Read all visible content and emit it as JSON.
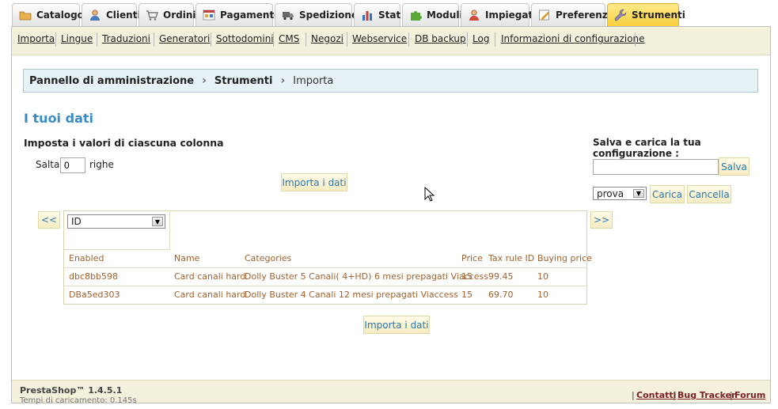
{
  "tabs": [
    {
      "label": "Catalogo",
      "icon": "folder-icon",
      "color": "#e3a53b"
    },
    {
      "label": "Clienti",
      "icon": "user-icon",
      "color": "#4a7bbf"
    },
    {
      "label": "Ordini",
      "icon": "cart-icon",
      "color": "#888888"
    },
    {
      "label": "Pagamento",
      "icon": "payment-icon",
      "color": "#c04040"
    },
    {
      "label": "Spedizione",
      "icon": "truck-icon",
      "color": "#555555"
    },
    {
      "label": "Stat",
      "icon": "bar-chart-icon",
      "color": "#3b6fc4"
    },
    {
      "label": "Moduli",
      "icon": "puzzle-icon",
      "color": "#5aa83a"
    },
    {
      "label": "Impiegati",
      "icon": "employee-icon",
      "color": "#d04a3a"
    },
    {
      "label": "Preferenze",
      "icon": "preferences-icon",
      "color": "#d9a23a"
    },
    {
      "label": "Strumenti",
      "icon": "wrench-icon",
      "color": "#6a6aa8"
    }
  ],
  "subnav": [
    "Importa",
    "Lingue",
    "Traduzioni",
    "Generatori",
    "Sottodomini",
    "CMS",
    "Negozi",
    "Webservice",
    "DB backup",
    "Log",
    "Informazioni di configurazione"
  ],
  "breadcrumb": {
    "root": "Pannello di amministrazione",
    "section": "Strumenti",
    "current": "Importa"
  },
  "page_title": "I tuoi dati",
  "column_heading": "Imposta i valori di ciascuna colonna",
  "skip": {
    "label_before": "Salta",
    "value": "0",
    "label_after": "righe"
  },
  "import_button_label": "Importa i dati",
  "config": {
    "heading": "Salva e carica la tua configurazione :",
    "name_value": "",
    "save_label": "Salva",
    "selected": "prova",
    "load_label": "Carica",
    "delete_label": "Cancella"
  },
  "nav": {
    "prev": "<<",
    "next": ">>"
  },
  "column_select_value": "ID",
  "table": {
    "headers": [
      "Enabled",
      "Name",
      "Categories",
      "Price",
      "Tax rule ID",
      "Buying price"
    ],
    "rows": [
      [
        "dbc8bb598",
        "Card canali hard",
        "Dolly Buster 5 Canali( 4+HD) 6 mesi prepagati Viaccess",
        "15",
        "99.45",
        "10"
      ],
      [
        "DBa5ed303",
        "Card canali hard",
        "Dolly Buster 4 Canali 12 mesi prepagati Viaccess",
        "15",
        "69.70",
        "10"
      ]
    ]
  },
  "footer": {
    "version": "PrestaShop™ 1.4.5.1",
    "load_time": "Tempi di caricamento: 0.145s",
    "links": [
      "Contatti",
      "Bug Tracker",
      "Forum"
    ]
  },
  "colors": {
    "accent": "#3a8bc4",
    "tab_active": "#f7cf3e",
    "data_text": "#a0622e",
    "footer_link": "#7a1f1f"
  }
}
